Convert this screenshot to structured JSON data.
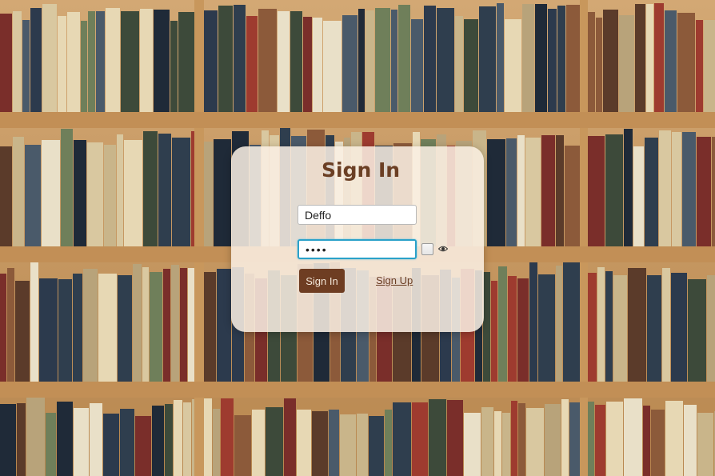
{
  "colors": {
    "accent": "#6e3d22",
    "title": "#6b3f24",
    "focus_border": "#2aa1c9",
    "panel_bg": "#faf0e4"
  },
  "signin": {
    "title": "Sign In",
    "username_value": "Deffo",
    "password_value": "••••",
    "show_password_icon": "eye-icon",
    "signin_button": "Sign In",
    "signup_link": "Sign Up"
  }
}
